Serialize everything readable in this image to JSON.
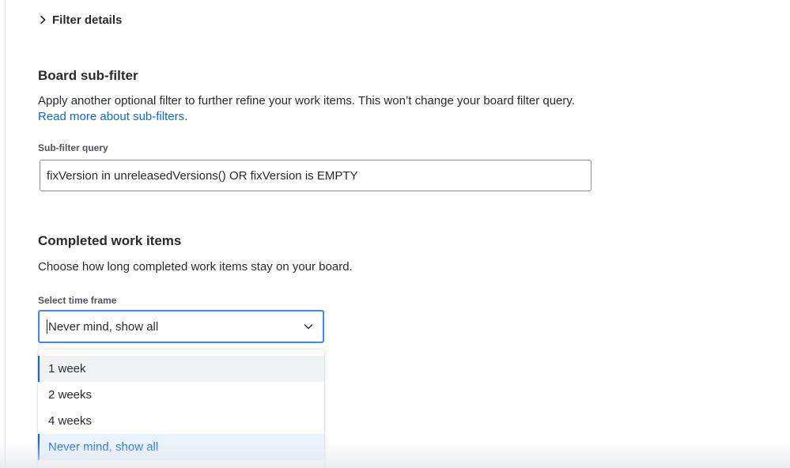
{
  "filter_details": {
    "label": "Filter details",
    "icon": "chevron-right-icon"
  },
  "subfilter": {
    "title": "Board sub-filter",
    "description": "Apply another optional filter to further refine your work items. This won’t change your board filter query.",
    "link": "Read more about sub-filters",
    "after_link": ".",
    "field_label": "Sub-filter query",
    "query_value": "fixVersion in unreleasedVersions() OR fixVersion is EMPTY"
  },
  "completed": {
    "title": "Completed work items",
    "description": "Choose how long completed work items stay on your board.",
    "field_label": "Select time frame",
    "selected": "Never mind, show all",
    "options": [
      {
        "label": "1 week"
      },
      {
        "label": "2 weeks"
      },
      {
        "label": "4 weeks"
      },
      {
        "label": "Never mind, show all"
      }
    ]
  },
  "colors": {
    "accent": "#0c66e4",
    "focus_border": "#388bff",
    "selected_bg": "#e9f2ff",
    "hover_bg": "#f1f2f4"
  }
}
